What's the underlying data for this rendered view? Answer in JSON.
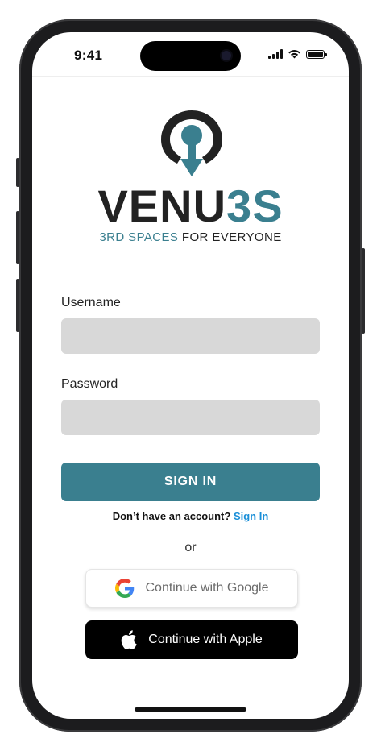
{
  "status_bar": {
    "time": "9:41"
  },
  "brand": {
    "name_part1": "VENU",
    "name_part2": "3S",
    "tagline_part1": "3RD SPACES",
    "tagline_part2": "FOR EVERYONE",
    "accent_color": "#3a7f8f",
    "dark_color": "#222222"
  },
  "form": {
    "username_label": "Username",
    "username_value": "",
    "password_label": "Password",
    "password_value": "",
    "signin_label": "SIGN IN"
  },
  "account_prompt": {
    "text": "Don’t have an account?",
    "link": "Sign In"
  },
  "divider_text": "or",
  "social": {
    "google_label": "Continue with Google",
    "apple_label": "Continue with Apple"
  },
  "icons": [
    "logo-icon",
    "signal-icon",
    "wifi-icon",
    "battery-icon",
    "google-icon",
    "apple-icon"
  ]
}
